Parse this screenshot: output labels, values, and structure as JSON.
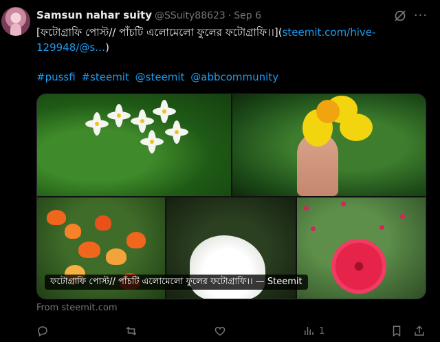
{
  "author": {
    "name": "Samsun nahar suity",
    "handle": "@SSuity88623",
    "separator": "·",
    "date": "Sep 6"
  },
  "tweet": {
    "text_prefix": "[ফটোগ্রাফি পোস্ট// পাঁচটি এলোমেলো ফুলের ফটোগ্রাফি।।](",
    "link_text": "steemit.com/hive-129948/@s…",
    "text_suffix": ")",
    "hashtags": [
      "#pussfi",
      "#steemit",
      "@steemit",
      "@abbcommunity"
    ]
  },
  "media": {
    "caption": "ফটোগ্রাফি পোস্ট// পাঁচটি এলোমেলো ফুলের ফটোগ্রাফি।। — Steemit",
    "source": "From steemit.com"
  },
  "actions": {
    "reply_count": "",
    "retweet_count": "",
    "like_count": "",
    "views_count": "1"
  },
  "icons": [
    "grok-icon",
    "more-icon",
    "reply-icon",
    "retweet-icon",
    "like-icon",
    "views-icon",
    "bookmark-icon",
    "share-icon"
  ],
  "colors": {
    "background": "#000000",
    "text": "#e7e9ea",
    "muted": "#71767b",
    "link": "#1d9bf0"
  }
}
